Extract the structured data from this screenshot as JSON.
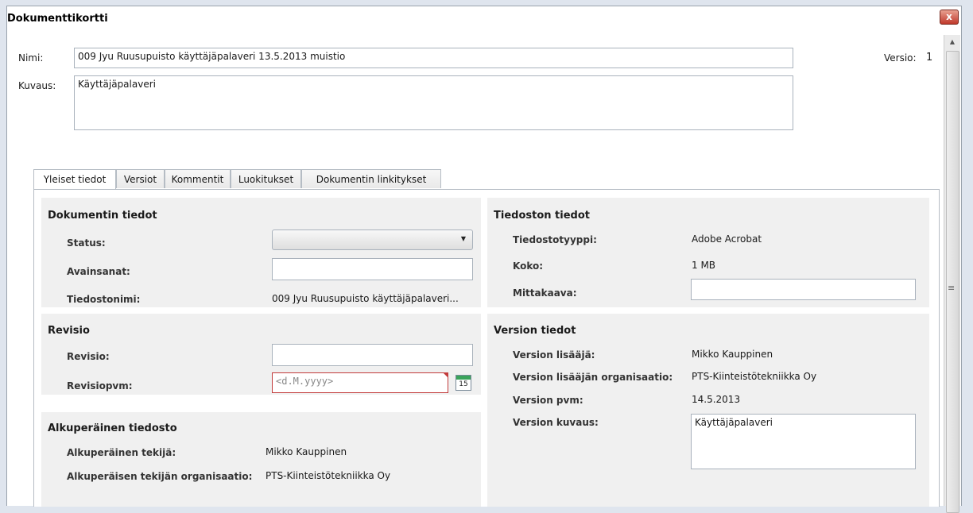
{
  "window": {
    "title": "Dokumenttikortti",
    "close_label": "x"
  },
  "header": {
    "name_label": "Nimi:",
    "name_value": "009 Jyu Ruusupuisto käyttäjäpalaveri 13.5.2013 muistio",
    "description_label": "Kuvaus:",
    "description_value": "Käyttäjäpalaveri",
    "version_label": "Versio:",
    "version_value": "1"
  },
  "tabs": [
    {
      "label": "Yleiset tiedot",
      "active": true
    },
    {
      "label": "Versiot"
    },
    {
      "label": "Kommentit"
    },
    {
      "label": "Luokitukset"
    },
    {
      "label": "Dokumentin linkitykset"
    }
  ],
  "document_info": {
    "title": "Dokumentin tiedot",
    "status_label": "Status:",
    "status_value": "",
    "keywords_label": "Avainsanat:",
    "keywords_value": "",
    "filename_label": "Tiedostonimi:",
    "filename_value": "009 Jyu Ruusupuisto käyttäjäpalaveri..."
  },
  "revision": {
    "title": "Revisio",
    "revision_label": "Revisio:",
    "revision_value": "",
    "date_label": "Revisiopvm:",
    "date_placeholder": "<d.M.yyyy>",
    "calendar_day": "15"
  },
  "original_file": {
    "title": "Alkuperäinen tiedosto",
    "author_label": "Alkuperäinen tekijä:",
    "author_value": "Mikko Kauppinen",
    "org_label": "Alkuperäisen tekijän organisaatio:",
    "org_value": "PTS-Kiinteistötekniikka Oy"
  },
  "file_info": {
    "title": "Tiedoston tiedot",
    "type_label": "Tiedostotyyppi:",
    "type_value": "Adobe Acrobat",
    "size_label": "Koko:",
    "size_value": "1 MB",
    "scale_label": "Mittakaava:",
    "scale_value": ""
  },
  "version_info": {
    "title": "Version tiedot",
    "adder_label": "Version lisääjä:",
    "adder_value": "Mikko Kauppinen",
    "adder_org_label": "Version lisääjän organisaatio:",
    "adder_org_value": "PTS-Kiinteistötekniikka Oy",
    "date_label": "Version pvm:",
    "date_value": "14.5.2013",
    "description_label": "Version kuvaus:",
    "description_value": "Käyttäjäpalaveri"
  }
}
